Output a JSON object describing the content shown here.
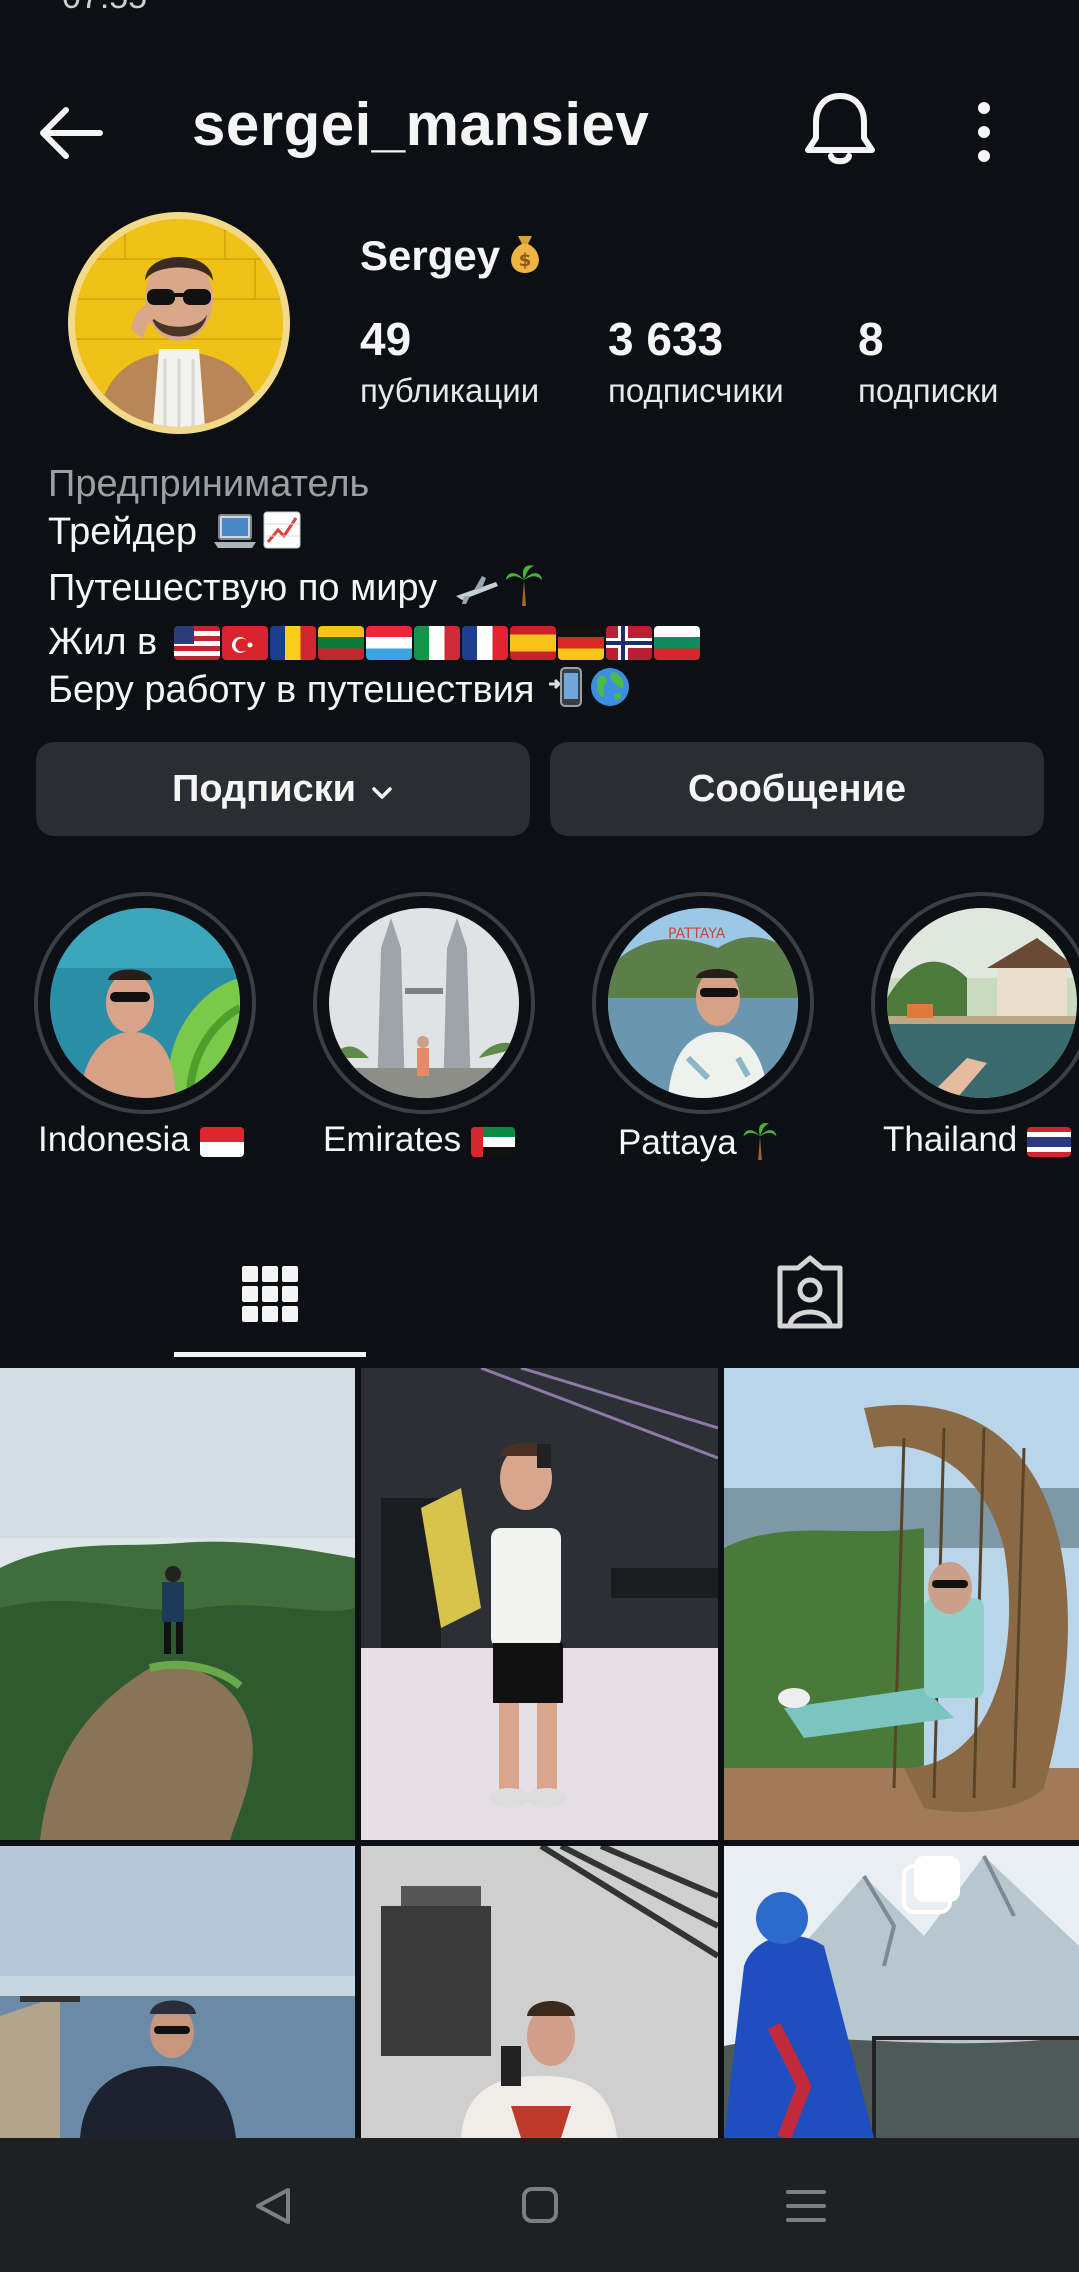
{
  "profile": {
    "username": "sergei_mansiev",
    "display_name": "Sergey",
    "stats": [
      {
        "value": "49",
        "label": "публикации"
      },
      {
        "value": "3 633",
        "label": "подписчики"
      },
      {
        "value": "8",
        "label": "подписки"
      }
    ],
    "category": "Предприниматель",
    "bio": {
      "line1": "Трейдер",
      "line2": "Путешествую по миру",
      "line3": "Жил в",
      "line4": "Беру работу в путешествия"
    }
  },
  "actions": {
    "following_label": "Подписки",
    "message_label": "Сообщение"
  },
  "highlights": [
    {
      "label": "Indonesia"
    },
    {
      "label": "Emirates"
    },
    {
      "label": "Pattaya"
    },
    {
      "label": "Thailand"
    }
  ],
  "tabs": {
    "active": "grid",
    "items": [
      "posts-grid-icon",
      "tagged-icon"
    ]
  },
  "icons": {
    "top": [
      "back-arrow-icon",
      "bell-icon",
      "more-vertical-icon"
    ],
    "nav": [
      "nav-back-icon",
      "nav-home-icon",
      "nav-menu-icon"
    ]
  },
  "colors": {
    "background": "#0c1014",
    "button": "#2a2e33",
    "text": "#f5f5f5",
    "muted": "#9aa0a6",
    "avatar_ring": "#f3d98a"
  }
}
